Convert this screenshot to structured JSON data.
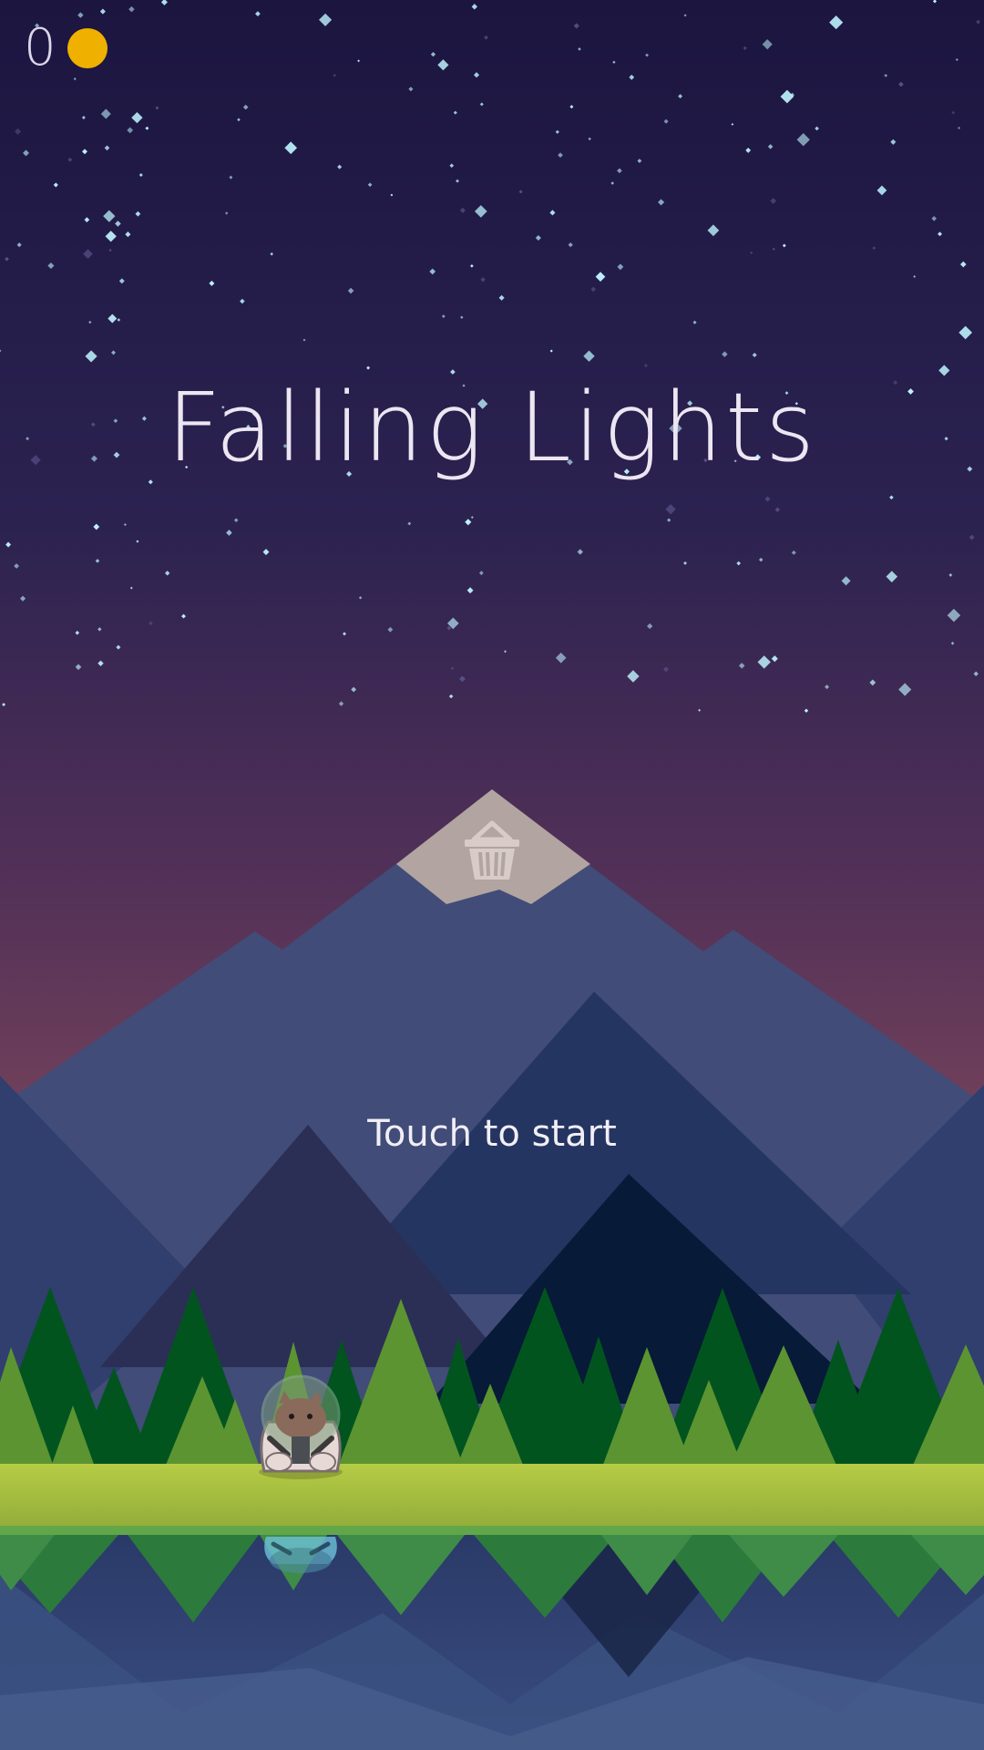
{
  "game": {
    "title": "Falling Lights",
    "start_prompt": "Touch to start"
  },
  "hud": {
    "coins": "0",
    "coin_icon": "gold-coin-icon"
  },
  "shop": {
    "icon": "basket-icon"
  },
  "player": {
    "character": "cat-astronaut"
  },
  "colors": {
    "sky_top": "#1b1540",
    "sky_horizon": "#70405a",
    "coin": "#f0b000",
    "star": "#bff4ff",
    "grass": "#a9c43f",
    "forest_dark": "#02541f",
    "forest_light": "#5c9432",
    "peak_snow": "#b2a4a0",
    "lake": "#2c4474"
  }
}
